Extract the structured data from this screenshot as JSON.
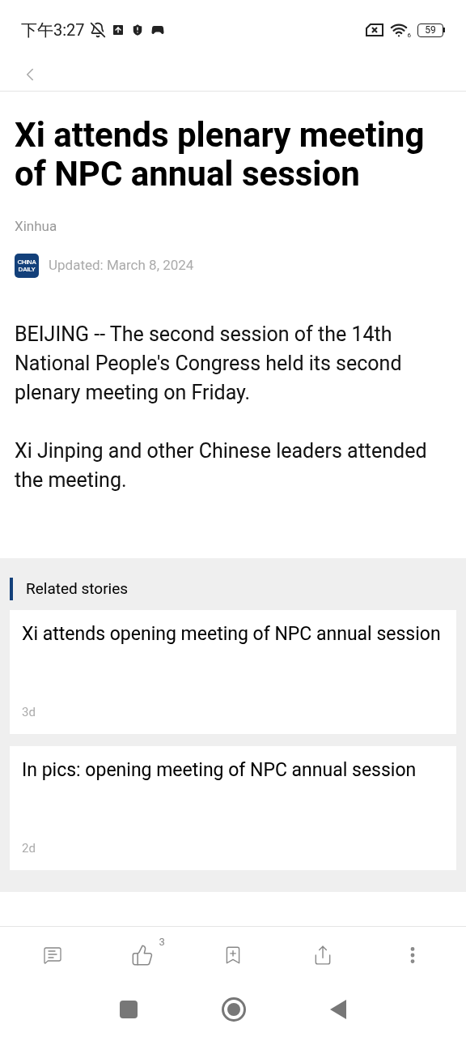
{
  "status_bar": {
    "time": "下午3:27",
    "wifi_label": "6",
    "battery": "59"
  },
  "article": {
    "title": "Xi attends plenary meeting of NPC annual session",
    "source": "Xinhua",
    "logo_lines": [
      "CHINA",
      "DAILY"
    ],
    "updated": "Updated: March 8, 2024",
    "paragraphs": [
      "BEIJING -- The second session of the 14th National People's Congress held its second plenary meeting on Friday.",
      "Xi Jinping and other Chinese leaders attended the meeting."
    ]
  },
  "related": {
    "heading": "Related stories",
    "items": [
      {
        "title": "Xi attends opening meeting of NPC annual session",
        "age": "3d"
      },
      {
        "title": "In pics: opening meeting of NPC annual session",
        "age": "2d"
      }
    ]
  },
  "toolbar": {
    "like_count": "3"
  }
}
